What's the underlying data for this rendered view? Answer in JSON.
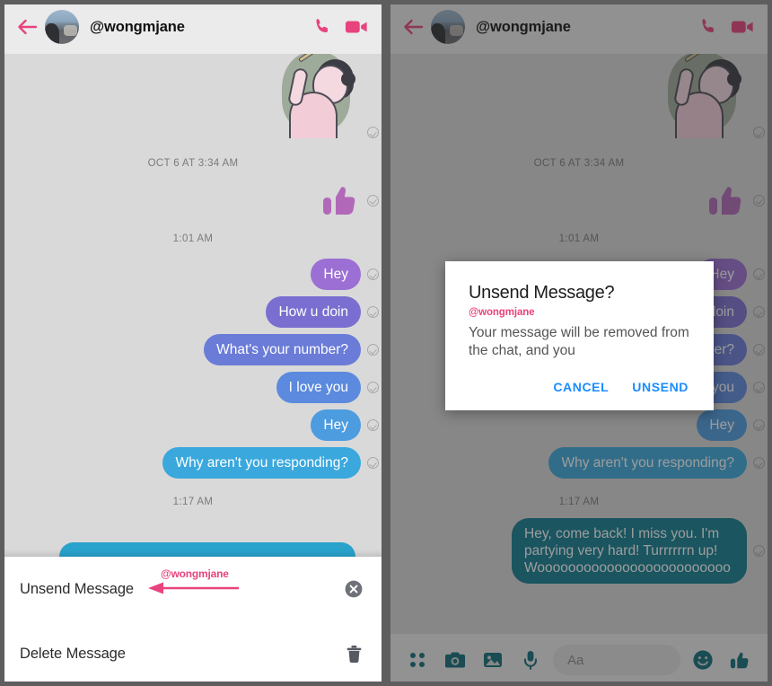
{
  "app": "Messenger Unsend Message",
  "header": {
    "back_icon": "arrow-left-icon",
    "avatar": "user-avatar",
    "title": "@wongmjane",
    "call_icon": "phone-icon",
    "video_icon": "video-camera-icon"
  },
  "thread": {
    "sticker": {
      "camera_badge": "camera-icon",
      "alt": "illustrated sticker of person with dark hair"
    },
    "timestamp_1": "OCT 6 AT 3:34 AM",
    "emoji": "thumbs-up-emoji",
    "timestamp_2": "1:01 AM",
    "messages": [
      {
        "text": "Hey",
        "color": "#9c6fd4"
      },
      {
        "text": "How u doin",
        "color": "#7a6fd0"
      },
      {
        "text": "What's your number?",
        "color": "#6a7bd8"
      },
      {
        "text": "I love you",
        "color": "#5b8ade"
      },
      {
        "text": "Hey",
        "color": "#4d9ce0"
      },
      {
        "text": "Why aren't you responding?",
        "color": "#3aa8dd"
      }
    ],
    "timestamp_3": "1:17 AM",
    "last_message": "Hey, come back! I miss you. I'm partying very hard! Turrrrrrn up! Wooooooooooooooooooooooooo",
    "last_message_color": "#0f7d91",
    "delivered_icon": "check-circle-icon"
  },
  "action_sheet": {
    "items": [
      {
        "label": "Unsend Message",
        "icon": "close-circle-icon"
      },
      {
        "label": "Delete Message",
        "icon": "trash-icon"
      }
    ]
  },
  "annotation": {
    "text": "@wongmjane",
    "icon": "arrow-left-annotation",
    "color": "#e8437e"
  },
  "dialog": {
    "title": "Unsend Message?",
    "handle": "@wongmjane",
    "body": "Your message will be removed from the chat, and you",
    "cancel_label": "CANCEL",
    "confirm_label": "UNSEND",
    "action_color": "#1a8cff"
  },
  "composer": {
    "apps_icon": "four-dot-grid-icon",
    "camera_icon": "camera-icon",
    "gallery_icon": "image-icon",
    "mic_icon": "microphone-icon",
    "input_placeholder": "Aa",
    "sticker_icon": "smiley-icon",
    "like_icon": "thumbs-up-icon",
    "accent": "#0d6b78"
  }
}
